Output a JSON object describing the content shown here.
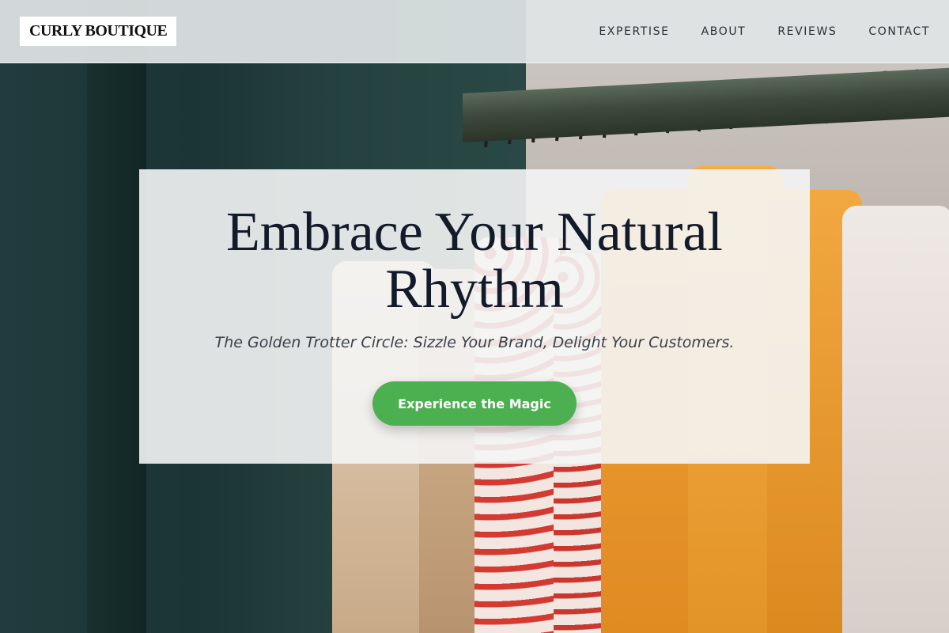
{
  "brand": {
    "logo_text": "CURLY BOUTIQUE"
  },
  "nav": {
    "items": [
      {
        "label": "EXPERTISE"
      },
      {
        "label": "ABOUT"
      },
      {
        "label": "REVIEWS"
      },
      {
        "label": "CONTACT"
      }
    ]
  },
  "hero": {
    "title": "Embrace Your Natural Rhythm",
    "subtitle": "The Golden Trotter Circle: Sizzle Your Brand, Delight Your Customers.",
    "cta_label": "Experience the Magic",
    "background_image": "clothing-rack-photo"
  },
  "colors": {
    "accent": "#4caf50",
    "title_text": "#131a2a",
    "header_bg": "#e0e4e5"
  }
}
